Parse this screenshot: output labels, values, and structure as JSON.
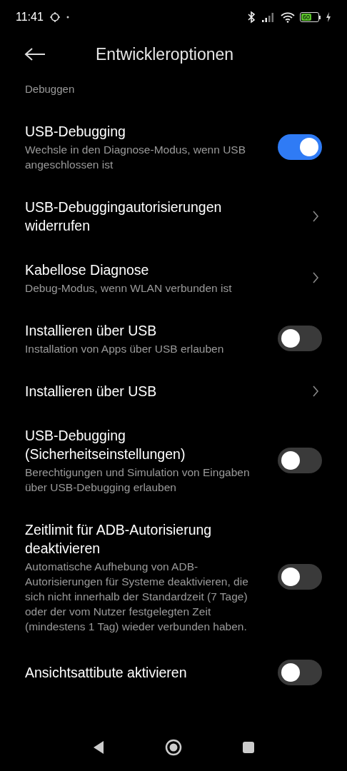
{
  "status_bar": {
    "time": "11:41",
    "battery": "60"
  },
  "header": {
    "title": "Entwickleroptionen"
  },
  "section": {
    "title": "Debuggen"
  },
  "items": [
    {
      "kind": "toggle",
      "title": "USB-Debugging",
      "subtitle": "Wechsle in den Diagnose-Modus, wenn USB angeschlossen ist",
      "on": true
    },
    {
      "kind": "link",
      "title": "USB-Debuggingautorisierungen widerrufen"
    },
    {
      "kind": "link",
      "title": "Kabellose Diagnose",
      "subtitle": "Debug-Modus, wenn WLAN verbunden ist"
    },
    {
      "kind": "toggle",
      "title": "Installieren über USB",
      "subtitle": "Installation von Apps über USB erlauben",
      "on": false
    },
    {
      "kind": "link",
      "title": "Installieren über USB"
    },
    {
      "kind": "toggle",
      "title": "USB-Debugging (Sicherheitseinstellungen)",
      "subtitle": "Berechtigungen und Simulation von Eingaben über USB-Debugging erlauben",
      "on": false
    },
    {
      "kind": "toggle",
      "title": "Zeitlimit für ADB-Autorisierung deaktivieren",
      "subtitle": "Automatische Aufhebung von ADB-Autorisierungen für Systeme deaktivieren, die sich nicht innerhalb der Standardzeit (7 Tage) oder der vom Nutzer festgelegten Zeit (mindestens 1 Tag) wieder verbunden haben.",
      "on": false
    },
    {
      "kind": "toggle",
      "title": "Ansichtsattibute aktivieren",
      "on": false
    }
  ]
}
